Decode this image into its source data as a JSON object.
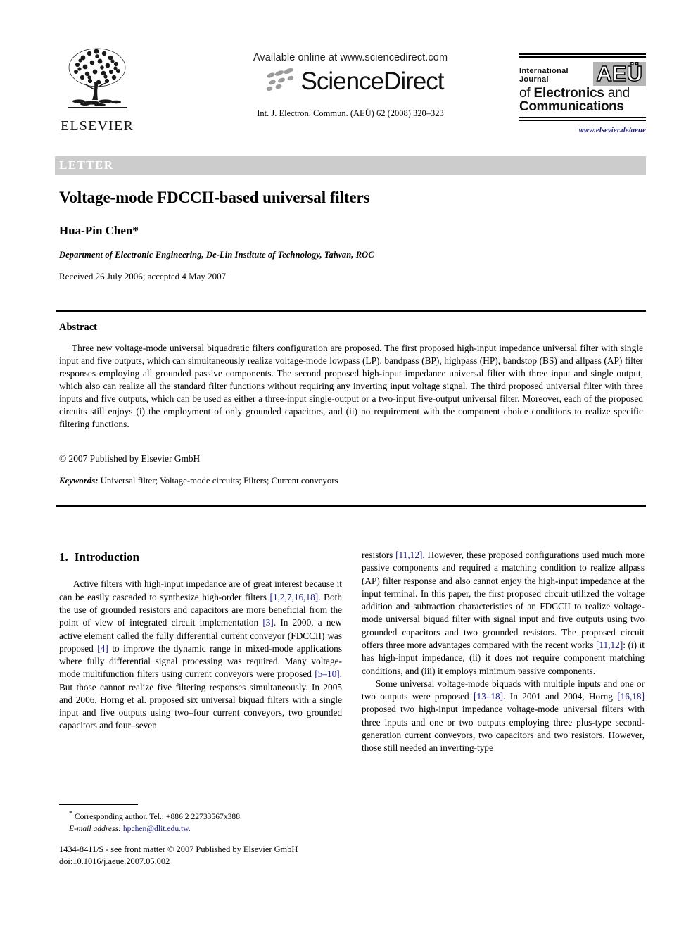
{
  "header": {
    "publisher_name": "ELSEVIER",
    "available_online": "Available online at www.sciencedirect.com",
    "sciencedirect_wordmark": "ScienceDirect",
    "citation_line": "Int. J. Electron. Commun. (AEÜ) 62 (2008) 320–323",
    "journal_logo": {
      "line1_small": "International Journal",
      "badge": "AEÜ",
      "line2_thin": "of ",
      "line2_bold": "Electronics",
      "line2_tail": " and",
      "line3": "Communications",
      "url": "www.elsevier.de/aeue"
    }
  },
  "article": {
    "type_band": "LETTER",
    "title": "Voltage-mode FDCCII-based universal filters",
    "author": "Hua-Pin Chen*",
    "affiliation": "Department of Electronic Engineering, De-Lin Institute of Technology, Taiwan, ROC",
    "dates": "Received 26 July 2006; accepted 4 May 2007"
  },
  "abstract": {
    "heading": "Abstract",
    "body": "Three new voltage-mode universal biquadratic filters configuration are proposed. The first proposed high-input impedance universal filter with single input and five outputs, which can simultaneously realize voltage-mode lowpass (LP), bandpass (BP), highpass (HP), bandstop (BS) and allpass (AP) filter responses employing all grounded passive components. The second proposed high-input impedance universal filter with three input and single output, which also can realize all the standard filter functions without requiring any inverting input voltage signal. The third proposed universal filter with three inputs and five outputs, which can be used as either a three-input single-output or a two-input five-output universal filter. Moreover, each of the proposed circuits still enjoys (i) the employment of only grounded capacitors, and (ii) no requirement with the component choice conditions to realize specific filtering functions.",
    "copyright": "© 2007 Published by Elsevier GmbH",
    "keywords_label": "Keywords:",
    "keywords_value": " Universal filter; Voltage-mode circuits; Filters; Current conveyors"
  },
  "body": {
    "section_number": "1.",
    "section_title": "Introduction",
    "left_paragraph_1": {
      "p1": "Active filters with high-input impedance are of great interest because it can be easily cascaded to synthesize high-order filters ",
      "c1": "[1,2,7,16,18]",
      "p2": ". Both the use of grounded resistors and capacitors are more beneficial from the point of view of integrated circuit implementation ",
      "c2": "[3]",
      "p3": ". In 2000, a new active element called the fully differential current conveyor (FDCCII) was proposed ",
      "c3": "[4]",
      "p4": " to improve the dynamic range in mixed-mode applications where fully differential signal processing was required. Many voltage-mode multifunction filters using current conveyors were proposed ",
      "c4": "[5–10]",
      "p5": ". But those cannot realize five filtering responses simultaneously. In 2005 and 2006, Horng et al. proposed six universal biquad filters with a single input and five outputs using two–four current conveyors, two grounded capacitors and four–seven"
    },
    "right_paragraph_1": {
      "p1": "resistors ",
      "c1": "[11,12]",
      "p2": ". However, these proposed configurations used much more passive components and required a matching condition to realize allpass (AP) filter response and also cannot enjoy the high-input impedance at the input terminal. In this paper, the first proposed circuit utilized the voltage addition and subtraction characteristics of an FDCCII to realize voltage-mode universal biquad filter with signal input and five outputs using two grounded capacitors and two grounded resistors. The proposed circuit offers three more advantages compared with the recent works ",
      "c2": "[11,12]",
      "p3": ": (i) it has high-input impedance, (ii) it does not require component matching conditions, and (iii) it employs minimum passive components."
    },
    "right_paragraph_2": {
      "p1": "Some universal voltage-mode biquads with multiple inputs and one or two outputs were proposed ",
      "c1": "[13–18]",
      "p2": ". In 2001 and 2004, Horng ",
      "c2": "[16,18]",
      "p3": " proposed two high-input impedance voltage-mode universal filters with three inputs and one or two outputs employing three plus-type second-generation current conveyors, two capacitors and two resistors. However, those still needed an inverting-type"
    }
  },
  "footnote": {
    "marker": "*",
    "corresponding": " Corresponding author. Tel.: +886 2 22733567x388.",
    "email_label": "E-mail address:",
    "email_value": " hpchen@dlit.edu.tw."
  },
  "imprint": {
    "line1": "1434-8411/$ - see front matter © 2007 Published by Elsevier GmbH",
    "line2": "doi:10.1016/j.aeue.2007.05.002"
  },
  "colors": {
    "band_gray": "#cccccc",
    "citation_blue": "#1a1a8c",
    "text_black": "#000000"
  }
}
